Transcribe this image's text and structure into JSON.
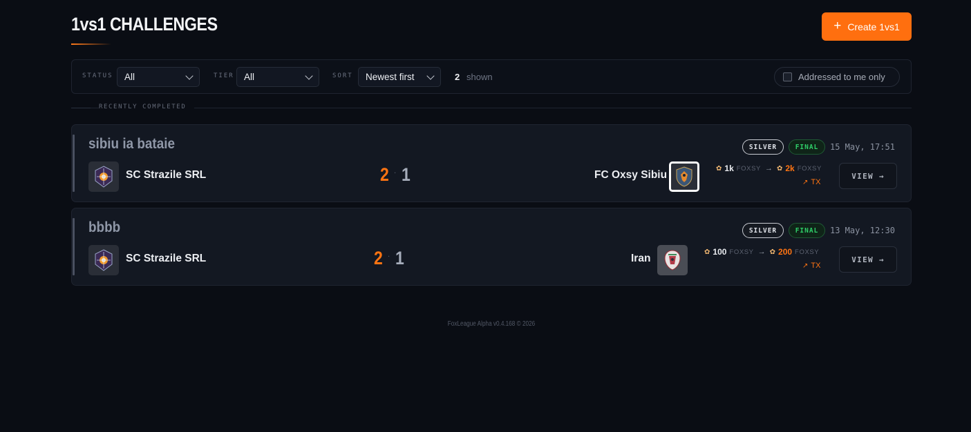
{
  "header": {
    "title": "1vs1 CHALLENGES",
    "create_label": "Create 1vs1",
    "create_icon": "plus-icon"
  },
  "filters": {
    "status_label": "STATUS",
    "status_value": "All",
    "tier_label": "TIER",
    "tier_value": "All",
    "sort_label": "SORT",
    "sort_value": "Newest first",
    "shown_count": "2",
    "shown_label": "shown",
    "addressed_label": "Addressed to me only",
    "addressed_checked": false
  },
  "section": {
    "label": "RECENTLY COMPLETED"
  },
  "challenges": [
    {
      "title": "sibiu ia bataie",
      "home_team": "SC Strazile SRL",
      "home_score": "2",
      "separator": "·",
      "away_score": "1",
      "away_team": "FC Oxsy Sibiu",
      "tier": "SILVER",
      "status": "FINAL",
      "date": "15 May, 17:51",
      "stake": "1k",
      "stake_unit": "FOXSY",
      "payout": "2k",
      "payout_unit": "FOXSY",
      "tx_label": "TX",
      "view_label": "VIEW →"
    },
    {
      "title": "bbbb",
      "home_team": "SC Strazile SRL",
      "home_score": "2",
      "separator": "·",
      "away_score": "1",
      "away_team": "Iran",
      "tier": "SILVER",
      "status": "FINAL",
      "date": "13 May, 12:30",
      "stake": "100",
      "stake_unit": "FOXSY",
      "payout": "200",
      "payout_unit": "FOXSY",
      "tx_label": "TX",
      "view_label": "VIEW →"
    }
  ],
  "footer": {
    "text": "FoxLeague Alpha v0.4.168 © 2026"
  },
  "colors": {
    "accent": "#ff6f0f",
    "background": "#0a0d14",
    "card": "#131822",
    "final_green": "#2fcf69"
  }
}
